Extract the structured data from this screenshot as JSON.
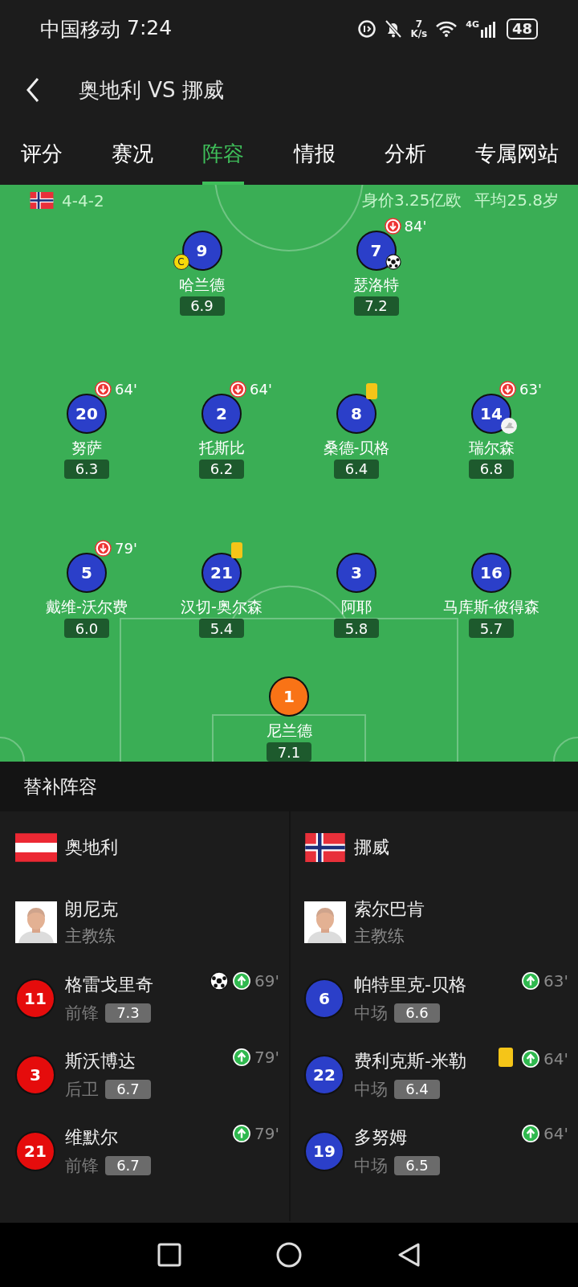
{
  "status_bar": {
    "carrier": "中国移动",
    "time": "7:24",
    "net_speed_value": "7",
    "net_speed_unit": "K/s",
    "network": "4G",
    "battery": "48"
  },
  "header": {
    "title": "奥地利 VS 挪威"
  },
  "tabs": [
    {
      "label": "评分",
      "selected": false
    },
    {
      "label": "赛况",
      "selected": false
    },
    {
      "label": "阵容",
      "selected": true
    },
    {
      "label": "情报",
      "selected": false
    },
    {
      "label": "分析",
      "selected": false
    },
    {
      "label": "专属网站",
      "selected": false
    }
  ],
  "lineup": {
    "kind": "norway",
    "formation": "4-4-2",
    "market_value": "身价3.25亿欧",
    "average_age": "平均25.8岁",
    "lines": [
      {
        "players": [
          {
            "number": "9",
            "name": "哈兰德",
            "rating": "6.9",
            "kind": "outfield",
            "events": [
              {
                "kind": "captain",
                "label": "C"
              }
            ]
          },
          {
            "number": "7",
            "name": "瑟洛特",
            "rating": "7.2",
            "kind": "outfield",
            "events": [
              {
                "kind": "sub_out",
                "minute": "84'"
              },
              {
                "kind": "goal"
              }
            ]
          }
        ]
      },
      {
        "players": [
          {
            "number": "20",
            "name": "努萨",
            "rating": "6.3",
            "kind": "outfield",
            "events": [
              {
                "kind": "sub_out",
                "minute": "64'"
              }
            ]
          },
          {
            "number": "2",
            "name": "托斯比",
            "rating": "6.2",
            "kind": "outfield",
            "events": [
              {
                "kind": "sub_out",
                "minute": "64'"
              }
            ]
          },
          {
            "number": "8",
            "name": "桑德-贝格",
            "rating": "6.4",
            "kind": "outfield",
            "events": [
              {
                "kind": "yellow_card"
              }
            ]
          },
          {
            "number": "14",
            "name": "瑞尔森",
            "rating": "6.8",
            "kind": "outfield",
            "events": [
              {
                "kind": "sub_out",
                "minute": "63'"
              },
              {
                "kind": "assist"
              }
            ]
          }
        ]
      },
      {
        "players": [
          {
            "number": "5",
            "name": "戴维-沃尔费",
            "rating": "6.0",
            "kind": "outfield",
            "events": [
              {
                "kind": "sub_out",
                "minute": "79'"
              }
            ]
          },
          {
            "number": "21",
            "name": "汉切-奥尔森",
            "rating": "5.4",
            "kind": "outfield",
            "events": [
              {
                "kind": "yellow_card"
              }
            ]
          },
          {
            "number": "3",
            "name": "阿耶",
            "rating": "5.8",
            "kind": "outfield"
          },
          {
            "number": "16",
            "name": "马库斯-彼得森",
            "rating": "5.7",
            "kind": "outfield"
          }
        ]
      },
      {
        "players": [
          {
            "number": "1",
            "name": "尼兰德",
            "rating": "7.1",
            "kind": "goalkeeper"
          }
        ]
      }
    ]
  },
  "substitutes": {
    "title": "替补阵容",
    "teams": [
      {
        "kind": "austria",
        "name": "奥地利",
        "color": "#e50c0c",
        "coach": {
          "name": "朗尼克",
          "role": "主教练"
        },
        "players": [
          {
            "number": "11",
            "name": "格雷戈里奇",
            "position": "前锋",
            "rating": "7.3",
            "events": [
              {
                "kind": "goal"
              },
              {
                "kind": "sub_in",
                "minute": "69'"
              }
            ]
          },
          {
            "number": "3",
            "name": "斯沃博达",
            "position": "后卫",
            "rating": "6.7",
            "events": [
              {
                "kind": "sub_in",
                "minute": "79'"
              }
            ]
          },
          {
            "number": "21",
            "name": "维默尔",
            "position": "前锋",
            "rating": "6.7",
            "events": [
              {
                "kind": "sub_in",
                "minute": "79'"
              }
            ]
          }
        ]
      },
      {
        "kind": "norway",
        "name": "挪威",
        "color": "#2b3fc9",
        "coach": {
          "name": "索尔巴肯",
          "role": "主教练"
        },
        "players": [
          {
            "number": "6",
            "name": "帕特里克-贝格",
            "position": "中场",
            "rating": "6.6",
            "events": [
              {
                "kind": "sub_in",
                "minute": "63'"
              }
            ]
          },
          {
            "number": "22",
            "name": "费利克斯-米勒",
            "position": "中场",
            "rating": "6.4",
            "events": [
              {
                "kind": "yellow_card"
              },
              {
                "kind": "sub_in",
                "minute": "64'"
              }
            ]
          },
          {
            "number": "19",
            "name": "多努姆",
            "position": "中场",
            "rating": "6.5",
            "events": [
              {
                "kind": "sub_in",
                "minute": "64'"
              }
            ]
          }
        ]
      }
    ]
  }
}
